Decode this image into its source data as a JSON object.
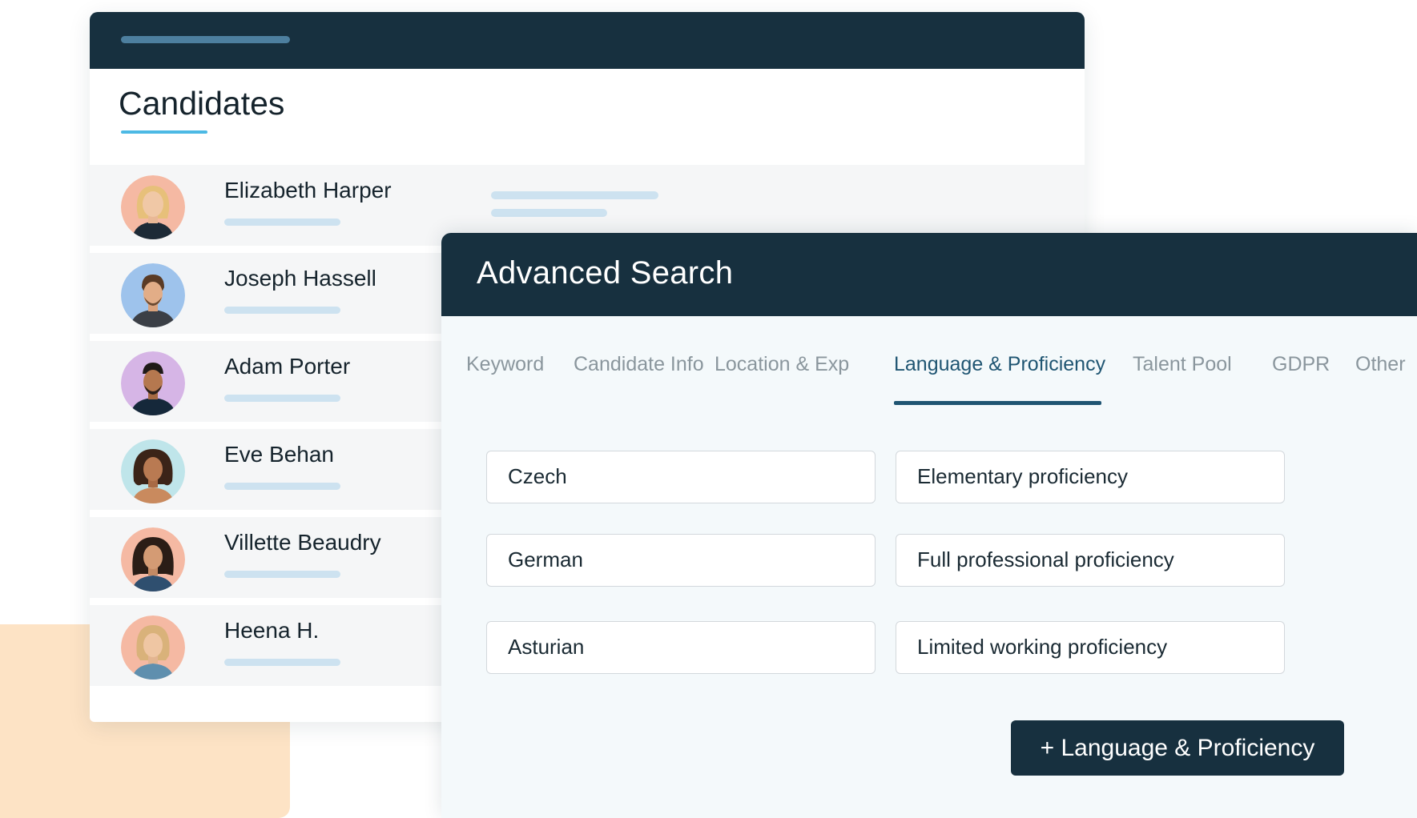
{
  "candidates": {
    "title": "Candidates",
    "list": [
      {
        "name": "Elizabeth Harper",
        "avatar_color": "#f5b9a3"
      },
      {
        "name": "Joseph Hassell",
        "avatar_color": "#9ec3ec"
      },
      {
        "name": "Adam Porter",
        "avatar_color": "#d6b5e6"
      },
      {
        "name": "Eve Behan",
        "avatar_color": "#bfe5ea"
      },
      {
        "name": "Villette Beaudry",
        "avatar_color": "#f5b9a3"
      },
      {
        "name": "Heena H.",
        "avatar_color": "#f5b9a3"
      }
    ]
  },
  "advanced_search": {
    "title": "Advanced Search",
    "tabs": [
      {
        "label": "Keyword"
      },
      {
        "label": "Candidate Info"
      },
      {
        "label": "Location & Exp"
      },
      {
        "label": "Language & Proficiency",
        "active": true
      },
      {
        "label": "Talent Pool"
      },
      {
        "label": "GDPR"
      },
      {
        "label": "Other"
      }
    ],
    "rows": [
      {
        "language": "Czech",
        "proficiency": "Elementary proficiency"
      },
      {
        "language": "German",
        "proficiency": "Full professional proficiency"
      },
      {
        "language": "Asturian",
        "proficiency": "Limited working proficiency"
      }
    ],
    "add_button_label": "+ Language & Proficiency"
  },
  "colors": {
    "header_dark": "#17303f",
    "accent_underline": "#4cb9e4",
    "active_tab": "#1f5572",
    "placeholder_bar": "#cde2f0",
    "peach_block": "#fde3c5"
  }
}
